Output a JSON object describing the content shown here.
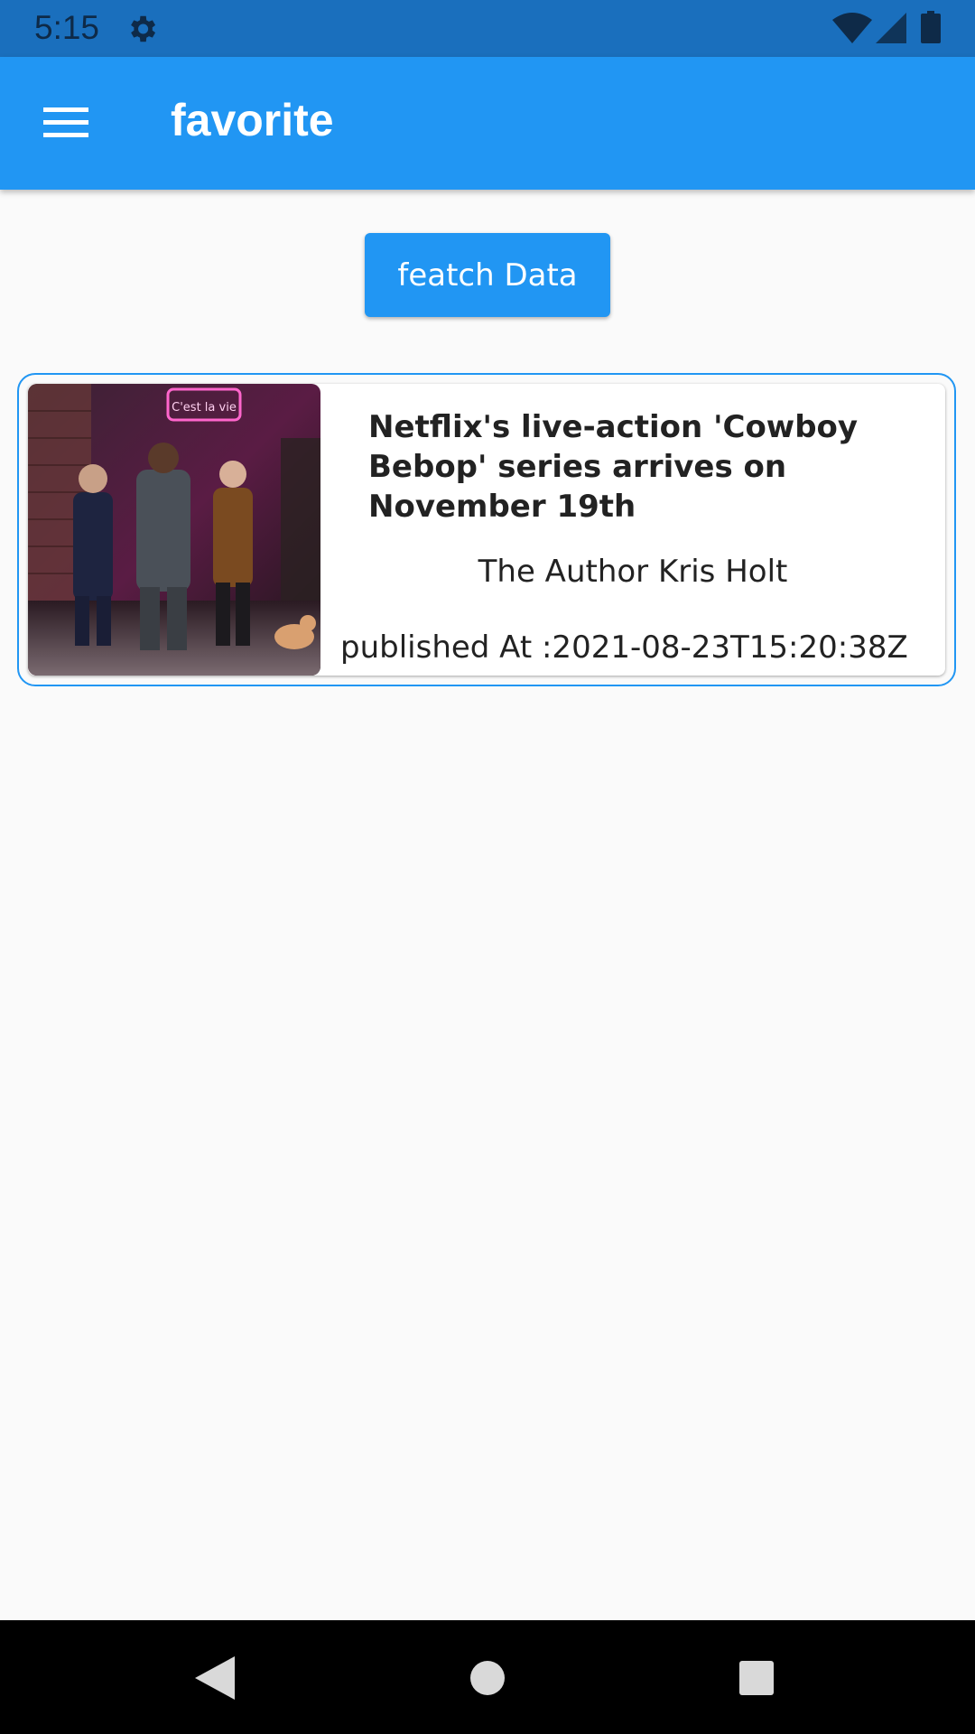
{
  "status_bar": {
    "time": "5:15",
    "icons": [
      "gear-icon",
      "wifi-icon",
      "cell-signal-icon",
      "battery-icon"
    ]
  },
  "app_bar": {
    "menu_icon": "hamburger-menu-icon",
    "title": "favorite",
    "color": "#2196f3"
  },
  "main": {
    "fetch_button_label": "featch Data"
  },
  "articles": [
    {
      "title": "Netflix's live-action 'Cowboy Bebop' series arrives on November 19th",
      "author": "The Author Kris Holt",
      "published": "published At :2021-08-23T15:20:38Z",
      "image_sign": "C'est la vie"
    }
  ],
  "nav_bar": {
    "icons": [
      "back-icon",
      "home-icon",
      "recents-icon"
    ]
  }
}
